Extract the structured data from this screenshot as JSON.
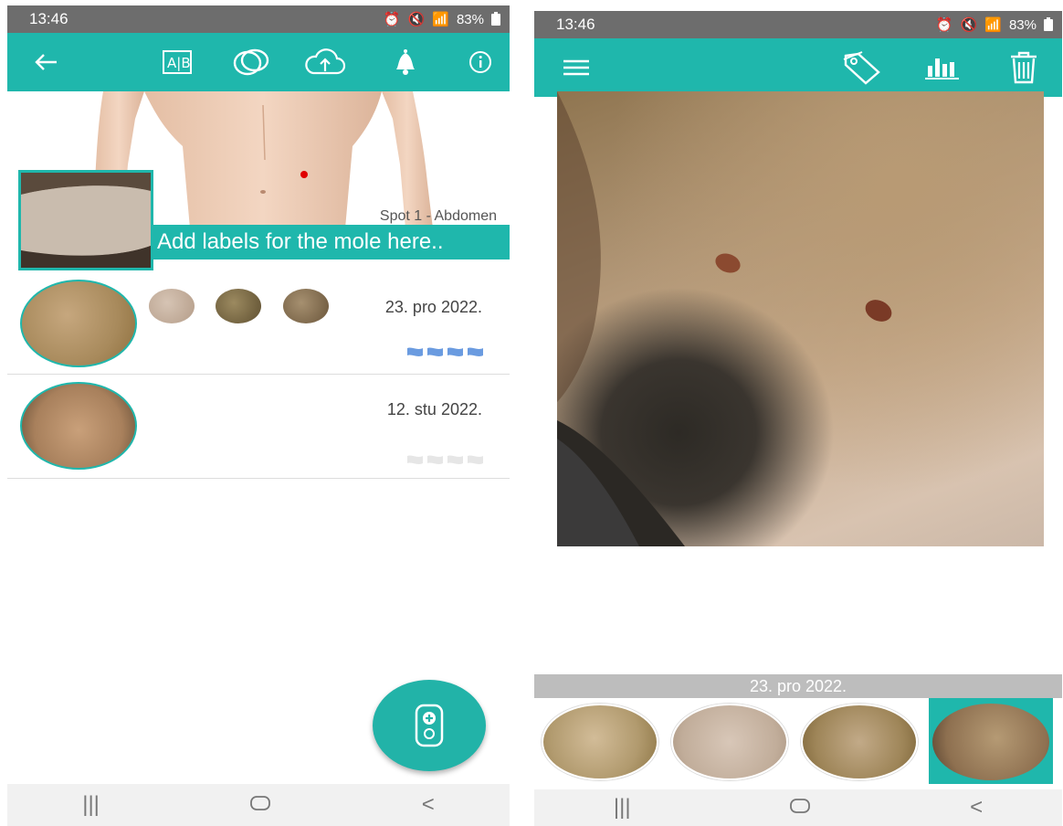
{
  "left_screen": {
    "status": {
      "time": "13:46",
      "battery": "83%"
    },
    "toolbar": {
      "back_icon": "arrow-left-icon",
      "compare_icon": "ab-compare-icon",
      "overlay_icon": "overlap-circles-icon",
      "upload_icon": "cloud-upload-icon",
      "bell_icon": "bell-icon",
      "info_icon": "info-icon"
    },
    "body_map": {
      "spot_label": "Spot 1 - Abdomen",
      "labels_prompt": "Add labels for the mole here..",
      "marker_color": "#e00000"
    },
    "entries": [
      {
        "date": "23. pro 2022.",
        "flags_active": true
      },
      {
        "date": "12. stu 2022.",
        "flags_active": false
      }
    ],
    "fab_icon": "add-device-icon"
  },
  "right_screen": {
    "status": {
      "time": "13:46",
      "battery": "83%"
    },
    "toolbar": {
      "menu_icon": "hamburger-menu-icon",
      "tag_icon": "tag-icon",
      "chart_icon": "bar-chart-icon",
      "delete_icon": "trash-icon"
    },
    "date_header": "23. pro 2022.",
    "selected_index": 3
  },
  "colors": {
    "accent": "#1fb7ac",
    "flag_active": "#6a9be0",
    "flag_inactive": "#e6e6e6"
  },
  "navbar": {
    "recents": "|||",
    "home": "○",
    "back": "<"
  }
}
